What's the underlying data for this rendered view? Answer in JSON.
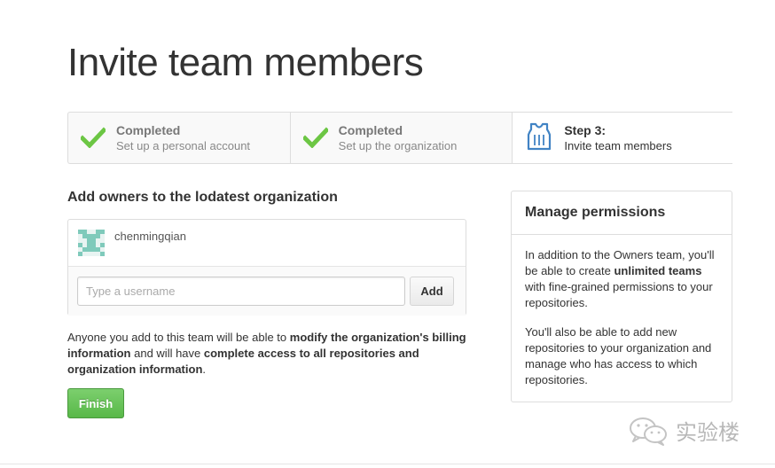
{
  "page": {
    "title": "Invite team members"
  },
  "steps": [
    {
      "title": "Completed",
      "description": "Set up a personal account",
      "status": "completed",
      "icon": "check-icon"
    },
    {
      "title": "Completed",
      "description": "Set up the organization",
      "status": "completed",
      "icon": "check-icon"
    },
    {
      "title": "Step 3:",
      "description": "Invite team members",
      "status": "current",
      "icon": "jersey-icon"
    }
  ],
  "owners": {
    "heading": "Add owners to the lodatest organization",
    "members": [
      {
        "username": "chenmingqian"
      }
    ],
    "input": {
      "value": "",
      "placeholder": "Type a username"
    },
    "add_label": "Add"
  },
  "info": {
    "part1": "Anyone you add to this team will be able to ",
    "bold1": "modify the organization's billing information",
    "part2": " and will have ",
    "bold2": "complete access to all repositories and organization information",
    "part3": "."
  },
  "finish_label": "Finish",
  "permissions": {
    "heading": "Manage permissions",
    "p1_before": "In addition to the Owners team, you'll be able to create ",
    "p1_bold": "unlimited teams",
    "p1_after": " with fine-grained permissions to your repositories.",
    "p2": "You'll also be able to add new repositories to your organization and manage who has access to which repositories."
  },
  "watermark": {
    "text": "实验楼",
    "icon": "wechat-icon"
  },
  "colors": {
    "check_green": "#6cc644",
    "jersey_blue": "#4183c4",
    "finish_green": "#60b850"
  }
}
